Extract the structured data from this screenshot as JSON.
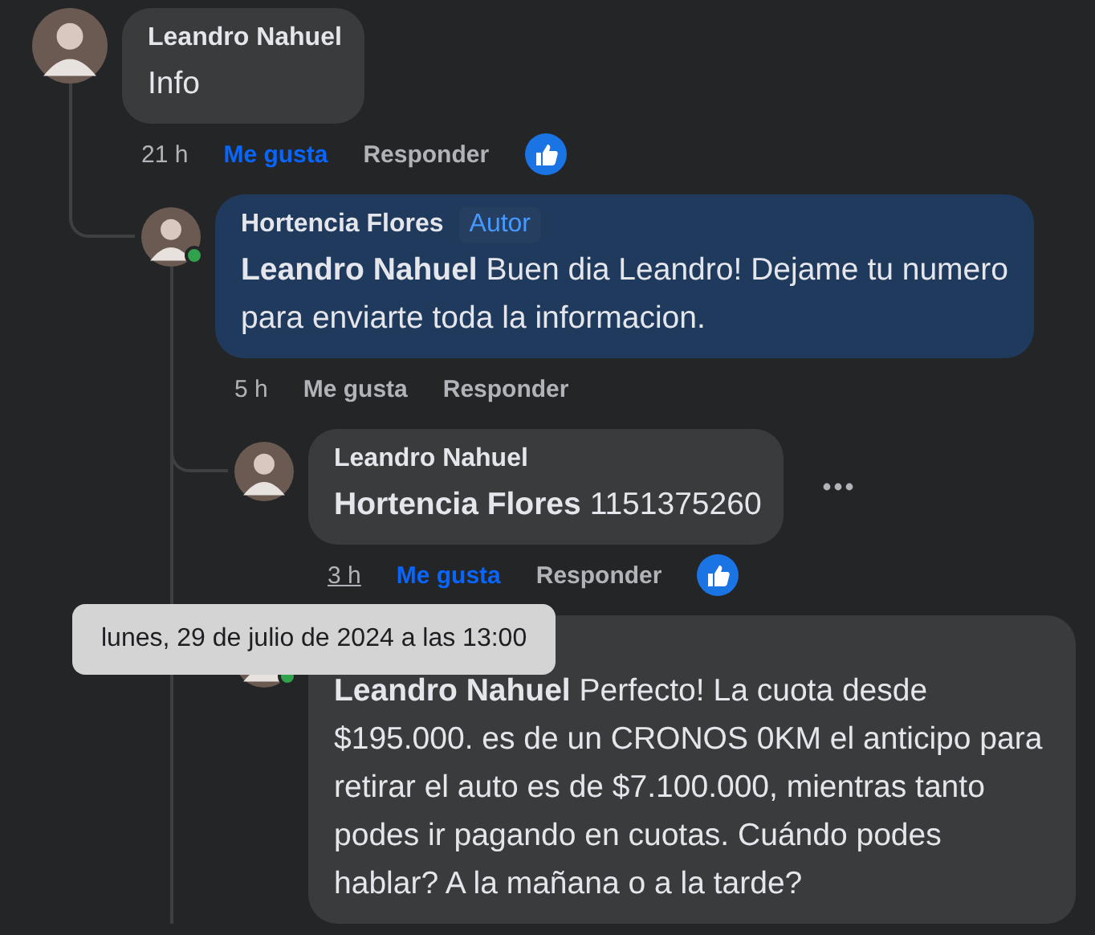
{
  "comments": [
    {
      "author": "Leandro Nahuel",
      "text": "Info",
      "author_post": false,
      "time": "21 h",
      "time_hovered": false,
      "like_label": "Me gusta",
      "liked": true,
      "reply_label": "Responder",
      "like_reaction": true,
      "children": [
        {
          "author": "Hortencia Flores",
          "badge": "Autor",
          "mention": "Leandro Nahuel",
          "text": "Buen dia Leandro! Dejame tu numero para enviarte toda la informacion.",
          "online": true,
          "author_post": true,
          "time": "5 h",
          "time_hovered": false,
          "like_label": "Me gusta",
          "liked": false,
          "reply_label": "Responder",
          "thread_continues": true,
          "children": [
            {
              "author": "Leandro Nahuel",
              "mention": "Hortencia Flores",
              "text": "1151375260",
              "author_post": false,
              "time": "3 h",
              "time_hovered": true,
              "like_label": "Me gusta",
              "liked": true,
              "reply_label": "Responder",
              "like_reaction": true,
              "show_menu": true
            },
            {
              "mention": "Leandro Nahuel",
              "text": "Perfecto! La cuota desde $195.000. es de un CRONOS 0KM el anticipo para retirar el auto es de $7.100.000, mientras tanto podes ir pagando en cuotas. Cuándo podes hablar? A la mañana o a la tarde?",
              "online": true,
              "author_post": false
            }
          ]
        }
      ]
    }
  ],
  "tooltip": {
    "text": "lunes, 29 de julio de 2024 a las 13:00"
  }
}
